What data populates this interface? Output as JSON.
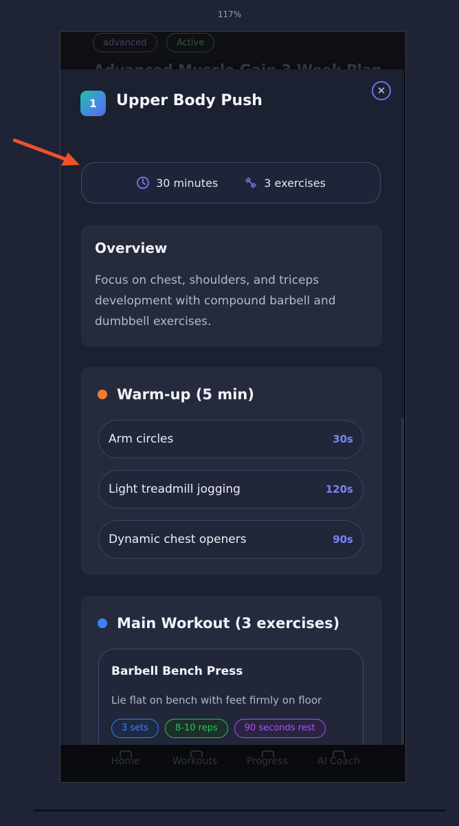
{
  "zoom_level": "117%",
  "background_screen": {
    "badges": [
      "advanced",
      "Active"
    ],
    "plan_title": "Advanced Muscle Gain 3-Week Plan",
    "nav": [
      "Home",
      "Workouts",
      "Progress",
      "AI Coach"
    ]
  },
  "modal": {
    "day_number": "1",
    "title": "Upper Body Push",
    "close_icon": "close-icon",
    "meta": {
      "duration": "30 minutes",
      "exercises": "3 exercises",
      "duration_icon": "clock-icon",
      "exercises_icon": "dumbbell-icon"
    },
    "overview": {
      "heading": "Overview",
      "text": "Focus on chest, shoulders, and triceps development with compound barbell and dumbbell exercises."
    },
    "warmup": {
      "heading": "Warm-up (5 min)",
      "dot_color": "#f07c2e",
      "items": [
        {
          "name": "Arm circles",
          "duration": "30s"
        },
        {
          "name": "Light treadmill jogging",
          "duration": "120s"
        },
        {
          "name": "Dynamic chest openers",
          "duration": "90s"
        }
      ]
    },
    "main_workout": {
      "heading": "Main Workout (3 exercises)",
      "dot_color": "#3b82f6",
      "exercises": [
        {
          "name": "Barbell Bench Press",
          "description": "Lie flat on bench with feet firmly on floor",
          "sets": "3 sets",
          "reps": "8-10 reps",
          "rest": "90 seconds rest"
        }
      ]
    }
  },
  "colors": {
    "accent": "#6d72e8",
    "annotation_arrow": "#f0512c",
    "tag_sets": "#3b82f6",
    "tag_reps": "#22c55e",
    "tag_rest": "#a855f7"
  }
}
